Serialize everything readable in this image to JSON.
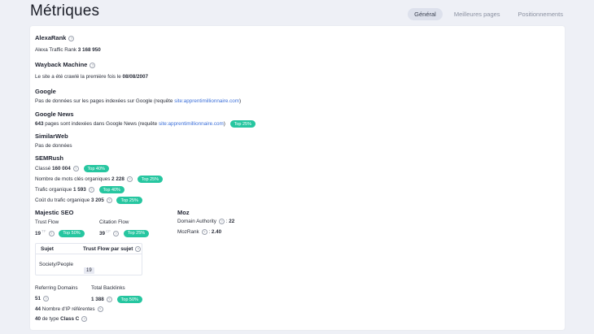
{
  "header": {
    "title": "Métriques",
    "tabs": [
      {
        "label": "Général",
        "active": true
      },
      {
        "label": "Meilleures pages",
        "active": false
      },
      {
        "label": "Positionnements",
        "active": false
      }
    ]
  },
  "alexa": {
    "title": "AlexaRank",
    "traffic_label": "Alexa Traffic Rank",
    "traffic_value": "3 168 950"
  },
  "wayback": {
    "title": "Wayback Machine",
    "text": "Le site a été crawlé la première fois le",
    "date": "08/08/2007"
  },
  "google": {
    "title": "Google",
    "text": "Pas de données sur les pages indexées sur Google (requête",
    "link": "site:apprentimillionnaire.com",
    "close": ")"
  },
  "google_news": {
    "title": "Google News",
    "count": "643",
    "text": "pages sont indexées dans Google News (requête",
    "link": "site:apprentimillionnaire.com",
    "close": ")",
    "badge": "Top 25%"
  },
  "similarweb": {
    "title": "SimilarWeb",
    "text": "Pas de données"
  },
  "semrush": {
    "title": "SEMRush",
    "rows": [
      {
        "label": "Classé",
        "value": "160 004",
        "badge": "Top 40%"
      },
      {
        "label": "Nombre de mots clés organiques",
        "value": "2 228",
        "badge": "Top 25%"
      },
      {
        "label": "Trafic organique",
        "value": "1 593",
        "badge": "Top 40%"
      },
      {
        "label": "Coût du trafic organique",
        "value": "3 205",
        "badge": "Top 25%"
      }
    ]
  },
  "majestic": {
    "title": "Majestic SEO",
    "trust_flow": {
      "label": "Trust Flow",
      "value": "19",
      "sup": "TF",
      "badge": "Top 50%"
    },
    "citation_flow": {
      "label": "Citation Flow",
      "value": "39",
      "sup": "CF",
      "badge": "Top 25%"
    },
    "table": {
      "col1": "Sujet",
      "col2": "Trust Flow par sujet",
      "rows": [
        {
          "subject": "Society/People",
          "value": "19"
        }
      ]
    },
    "referring_domains": {
      "label": "Referring Domains",
      "value": "51"
    },
    "total_backlinks": {
      "label": "Total Backlinks",
      "value": "1 388",
      "badge": "Top 50%"
    },
    "ips": {
      "value": "44",
      "label": "Nombre d'IP référentes"
    },
    "classc": {
      "value": "40",
      "prefix": "de type",
      "label": "Class C"
    }
  },
  "moz": {
    "title": "Moz",
    "domain_authority": {
      "label": "Domain Authority",
      "sep": ":",
      "value": "22"
    },
    "mozrank": {
      "label": "MozRank",
      "sep": ":",
      "value": "2.40"
    }
  },
  "colors": {
    "badge": "#26c6a0",
    "link": "#3b6fd9",
    "background": "#eef0f6"
  }
}
